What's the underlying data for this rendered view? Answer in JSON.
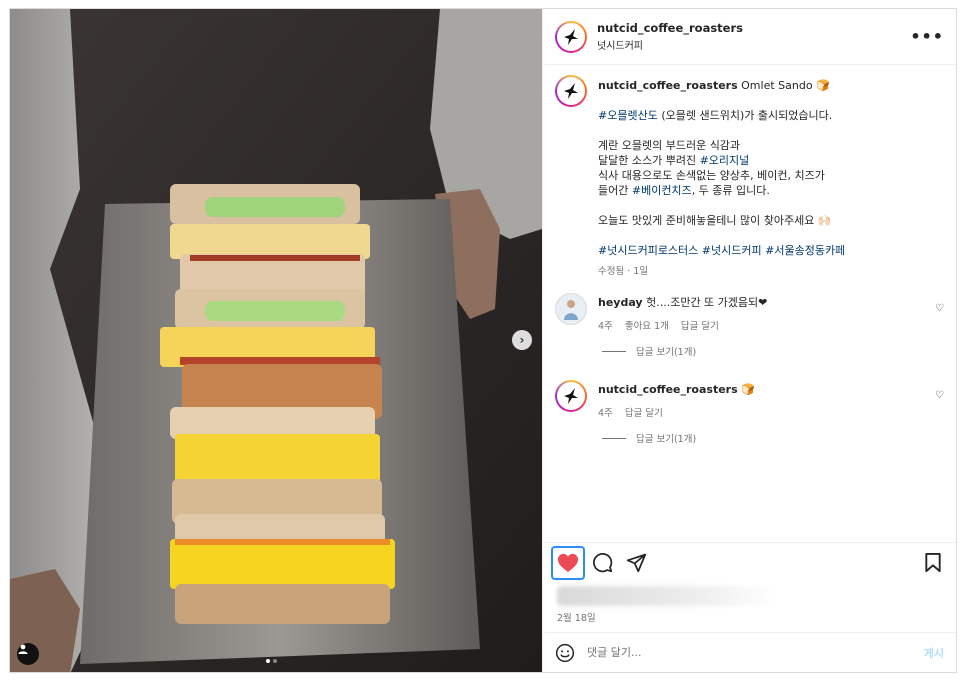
{
  "post": {
    "username": "nutcid_coffee_roasters",
    "subtitle": "넛시드커피",
    "more_icon": "more-horizontal-icon"
  },
  "caption": {
    "username": "nutcid_coffee_roasters",
    "title": "Omlet Sando 🍞",
    "line1_tag": "#오믈렛산도",
    "line1_rest": " (오믈렛 샌드위치)가 출시되었습니다.",
    "line2": "계란 오믈렛의 부드러운 식감과",
    "line3_pre": "달달한 소스가 뿌려진 ",
    "line3_tag": "#오리지널",
    "line4": "식사 대용으로도 손색없는 양상추, 베이컨, 치즈가",
    "line5_pre": "들어간 ",
    "line5_tag": "#베이컨치즈",
    "line5_rest": ", 두 종류 입니다.",
    "line6": "오늘도 맛있게 준비해놓을테니 많이 찾아주세요 🙌🏻",
    "hashtags": [
      "#넛시드커피로스터스",
      "#넛시드커피",
      "#서울송정동카페"
    ],
    "meta": "수정됨 · 1일"
  },
  "comments": [
    {
      "username": "heyday",
      "text": "헛....조만간 또 가겠음되❤",
      "time": "4주",
      "likes": "좋아요 1개",
      "reply": "답글 달기",
      "view_replies": "답글 보기(1개)"
    },
    {
      "username": "nutcid_coffee_roasters",
      "text": "🍞",
      "time": "4주",
      "reply": "답글 달기",
      "view_replies": "답글 보기(1개)"
    }
  ],
  "footer": {
    "date": "2월 18일",
    "comment_placeholder": "댓글 달기...",
    "post_label": "게시"
  },
  "colors": {
    "like_active": "#ed4956",
    "hashtag": "#00376b",
    "focus_ring": "#2f8ef5"
  }
}
